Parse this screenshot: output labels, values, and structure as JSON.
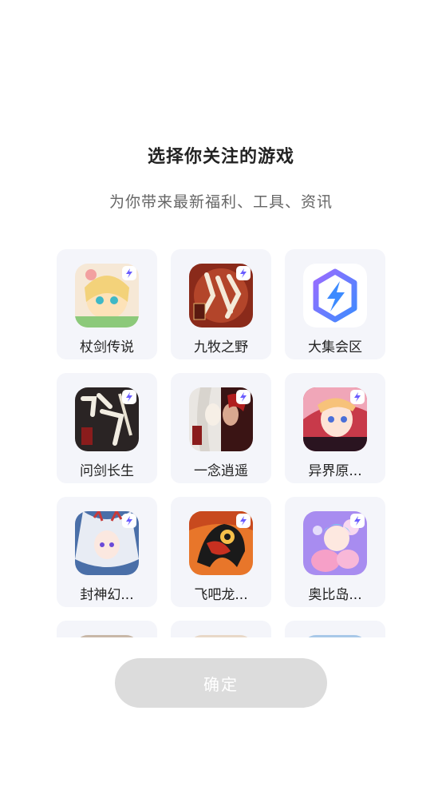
{
  "header": {
    "title": "选择你关注的游戏",
    "subtitle": "为你带来最新福利、工具、资讯"
  },
  "games": [
    {
      "name": "杖剑传说",
      "icon": "game-icon-zhangjian",
      "has_badge": true
    },
    {
      "name": "九牧之野",
      "icon": "game-icon-jiumu",
      "has_badge": true
    },
    {
      "name": "大集会区",
      "icon": "lightning-logo-icon",
      "has_badge": false
    },
    {
      "name": "问剑长生",
      "icon": "game-icon-wenjian",
      "has_badge": true
    },
    {
      "name": "一念逍遥",
      "icon": "game-icon-yinian",
      "has_badge": true
    },
    {
      "name": "异界原...",
      "icon": "game-icon-yijie",
      "has_badge": true
    },
    {
      "name": "封神幻...",
      "icon": "game-icon-fengshen",
      "has_badge": true
    },
    {
      "name": "飞吧龙...",
      "icon": "game-icon-feiba",
      "has_badge": true
    },
    {
      "name": "奥比岛...",
      "icon": "game-icon-aobi",
      "has_badge": true
    }
  ],
  "footer": {
    "confirm_label": "确定"
  },
  "colors": {
    "card_bg": "#f4f5fa",
    "button_disabled": "#dcdcdc",
    "brand_purple": "#7b5cff",
    "brand_blue": "#3d8bff"
  }
}
